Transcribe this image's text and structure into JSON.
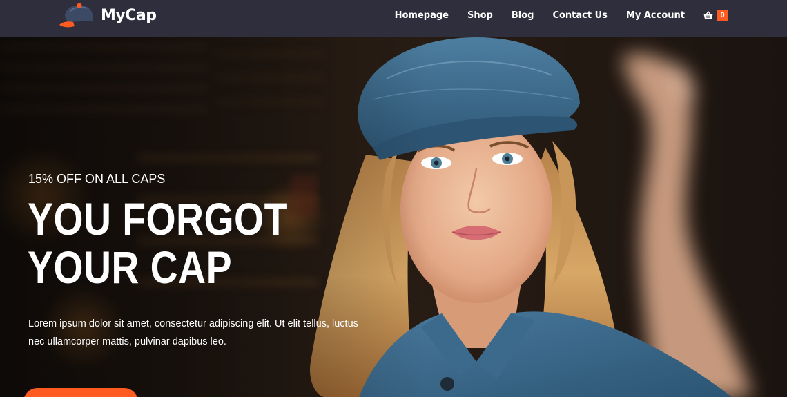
{
  "header": {
    "logo_text": "MyCap",
    "nav": {
      "homepage": "Homepage",
      "shop": "Shop",
      "blog": "Blog",
      "contact": "Contact Us",
      "account": "My Account"
    },
    "cart": {
      "icon": "basket-icon",
      "count": "0"
    }
  },
  "hero": {
    "eyebrow": "15% OFF ON ALL CAPS",
    "title": "YOU FORGOT YOUR CAP",
    "description": "Lorem ipsum dolor sit amet, consectetur adipiscing elit. Ut elit tellus, luctus nec ullamcorper mattis, pulvinar dapibus leo.",
    "cta_label": "",
    "image": "photo of woman wearing a blue denim flat cap"
  },
  "colors": {
    "header_bg": "#2e2e3c",
    "accent": "#ff5a1f",
    "cap_blue": "#3f6f91"
  }
}
